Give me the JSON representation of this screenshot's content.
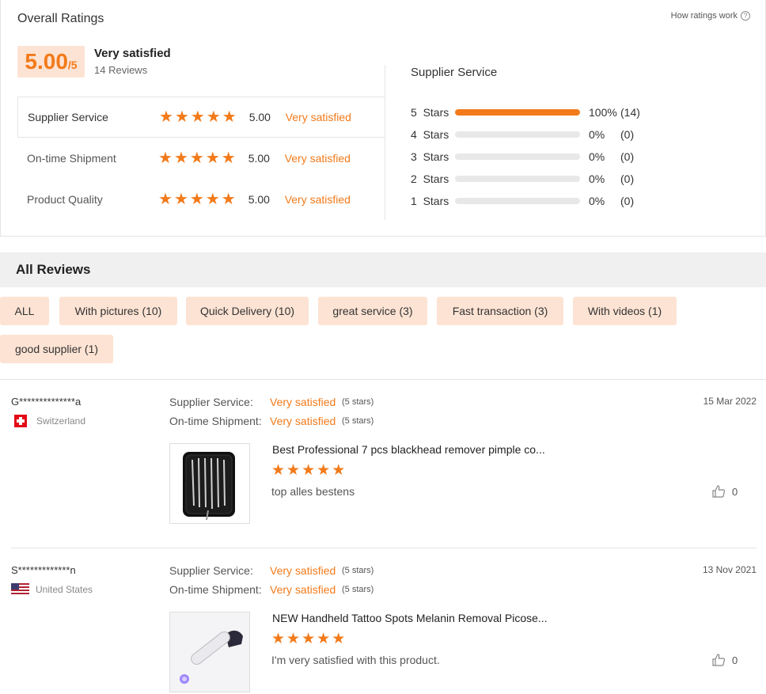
{
  "overall": {
    "title": "Overall Ratings",
    "how_link": "How ratings work",
    "score": "5.00",
    "score_suffix": "/5",
    "score_text": "Very satisfied",
    "review_count": "14 Reviews"
  },
  "sub_ratings": [
    {
      "label": "Supplier Service",
      "value": "5.00",
      "desc": "Very satisfied",
      "stars": 5
    },
    {
      "label": "On-time Shipment",
      "value": "5.00",
      "desc": "Very satisfied",
      "stars": 5
    },
    {
      "label": "Product Quality",
      "value": "5.00",
      "desc": "Very satisfied",
      "stars": 5
    }
  ],
  "distribution": {
    "title": "Supplier Service",
    "rows": [
      {
        "label": "5  Stars",
        "fraction": 1.0,
        "pct": "100%",
        "count": "(14)"
      },
      {
        "label": "4  Stars",
        "fraction": 0.0,
        "pct": "0%",
        "count": "(0)"
      },
      {
        "label": "3  Stars",
        "fraction": 0.0,
        "pct": "0%",
        "count": "(0)"
      },
      {
        "label": "2  Stars",
        "fraction": 0.0,
        "pct": "0%",
        "count": "(0)"
      },
      {
        "label": "1  Stars",
        "fraction": 0.0,
        "pct": "0%",
        "count": "(0)"
      }
    ]
  },
  "all_reviews": {
    "title": "All Reviews",
    "filters": [
      "ALL",
      "With pictures (10)",
      "Quick Delivery (10)",
      "great service (3)",
      "Fast transaction (3)",
      "With videos (1)",
      "good supplier (1)"
    ]
  },
  "reviews": [
    {
      "reviewer": "G**************a",
      "country": "Switzerland",
      "flag": "switzerland-flag",
      "date": "15 Mar 2022",
      "supplier_label": "Supplier Service:",
      "supplier_value": "Very satisfied",
      "supplier_stars": "(5 stars)",
      "shipment_label": "On-time Shipment:",
      "shipment_value": "Very satisfied",
      "shipment_stars": "(5 stars)",
      "product": "Best Professional 7 pcs blackhead remover pimple co...",
      "stars": 5,
      "comment": "top alles bestens",
      "likes": "0"
    },
    {
      "reviewer": "S*************n",
      "country": "United States",
      "flag": "united-states-flag",
      "date": "13 Nov 2021",
      "supplier_label": "Supplier Service:",
      "supplier_value": "Very satisfied",
      "supplier_stars": "(5 stars)",
      "shipment_label": "On-time Shipment:",
      "shipment_value": "Very satisfied",
      "shipment_stars": "(5 stars)",
      "product": "NEW Handheld Tattoo Spots Melanin Removal Picose...",
      "stars": 5,
      "comment": "I'm very satisfied with this product.",
      "likes": "0"
    }
  ],
  "colors": {
    "accent": "#f27a1a",
    "chip_bg": "#fde3d3",
    "header_bg": "#f0f0f0"
  }
}
